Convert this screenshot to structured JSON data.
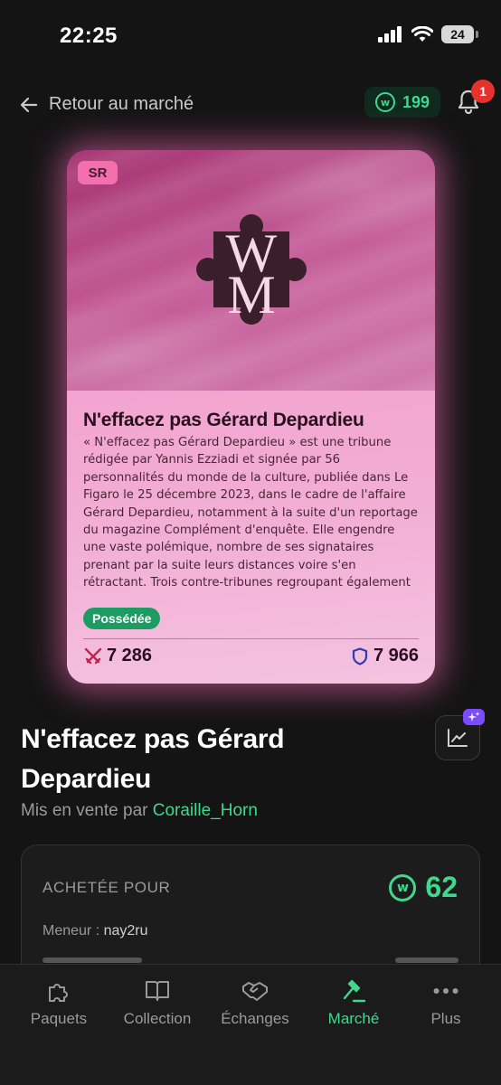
{
  "status_bar": {
    "time": "22:25",
    "battery": "24"
  },
  "top_nav": {
    "back_label": "Retour au marché",
    "coins": "199",
    "notifications": "1"
  },
  "card": {
    "rarity": "SR",
    "logo_text": "WM",
    "title": "N'effacez pas Gérard Depardieu",
    "description": "« N'effacez pas Gérard Depardieu » est une tribune rédigée par Yannis Ezziadi et signée par 56 personnalités du monde de la culture, publiée dans Le Figaro le 25 décembre 2023, dans le cadre de l'affaire Gérard Depardieu, notamment à la suite d'un reportage du magazine Complément d'enquête. Elle engendre une vaste polémique, nombre de ses signataires prenant par la suite leurs distances voire s'en rétractant. Trois contre-tribunes regroupant également des artistes, plus ou moins connus, sont publiées en...",
    "owned_label": "Possédée",
    "attack": "7 286",
    "defense": "7 966"
  },
  "listing": {
    "title": "N'effacez pas Gérard Depardieu",
    "seller_prefix": "Mis en vente par",
    "seller_name": "Coraille_Horn"
  },
  "purchase": {
    "label": "ACHETÉE POUR",
    "price": "62",
    "leader_label": "Meneur :",
    "leader_value": "nay2ru"
  },
  "bottom_nav": {
    "items": [
      {
        "label": "Paquets",
        "icon": "puzzle-icon"
      },
      {
        "label": "Collection",
        "icon": "book-icon"
      },
      {
        "label": "Échanges",
        "icon": "handshake-icon"
      },
      {
        "label": "Marché",
        "icon": "gavel-icon",
        "active": true
      },
      {
        "label": "Plus",
        "icon": "more-dots-icon"
      }
    ]
  },
  "colors": {
    "accent": "#3fd88c",
    "background": "#141414",
    "badge_red": "#e5322d",
    "card_pink": "#f2a4cf"
  }
}
